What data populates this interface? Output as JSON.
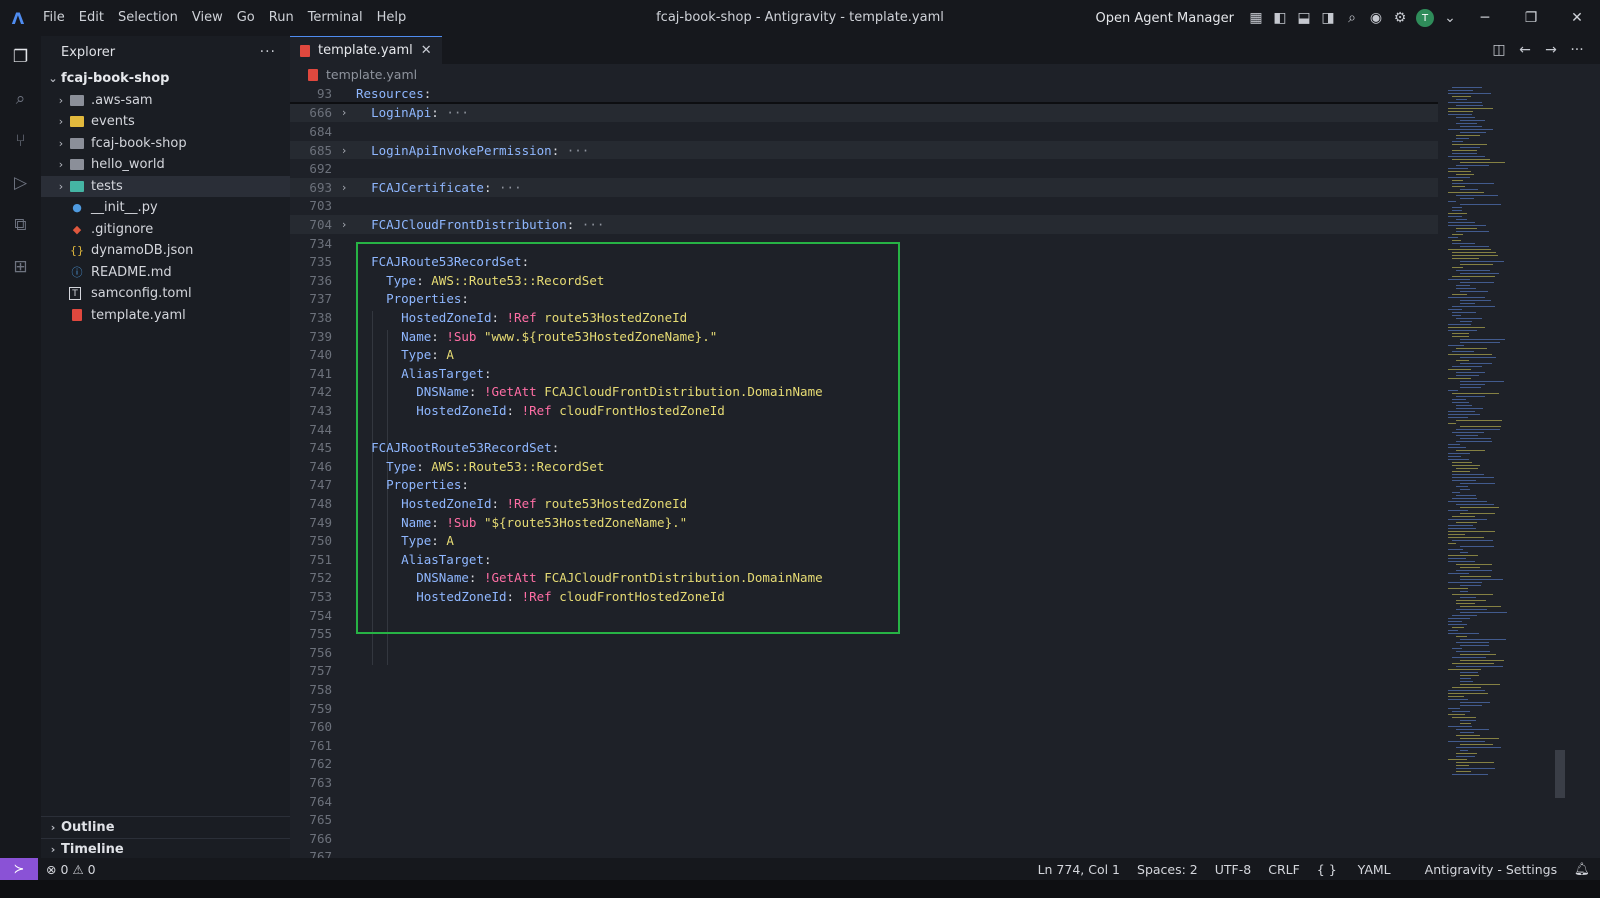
{
  "titlebar": {
    "menu": [
      "File",
      "Edit",
      "Selection",
      "View",
      "Go",
      "Run",
      "Terminal",
      "Help"
    ],
    "window_title": "fcaj-book-shop - Antigravity - template.yaml",
    "agent_manager": "Open Agent Manager",
    "avatar_initial": "T"
  },
  "sidebar": {
    "title": "Explorer",
    "root": "fcaj-book-shop",
    "items": [
      {
        "label": ".aws-sam",
        "kind": "folder"
      },
      {
        "label": "events",
        "kind": "folder"
      },
      {
        "label": "fcaj-book-shop",
        "kind": "folder"
      },
      {
        "label": "hello_world",
        "kind": "folder"
      },
      {
        "label": "tests",
        "kind": "folder"
      },
      {
        "label": "__init__.py",
        "kind": "python"
      },
      {
        "label": ".gitignore",
        "kind": "git"
      },
      {
        "label": "dynamoDB.json",
        "kind": "json"
      },
      {
        "label": "README.md",
        "kind": "info"
      },
      {
        "label": "samconfig.toml",
        "kind": "toml"
      },
      {
        "label": "template.yaml",
        "kind": "yaml"
      }
    ],
    "outline": "Outline",
    "timeline": "Timeline"
  },
  "editor": {
    "tab_label": "template.yaml",
    "breadcrumb": "template.yaml",
    "sticky": {
      "ln": "93",
      "key": "Resources"
    },
    "lines": {
      "l666": {
        "ln": "666",
        "key": "LoginApi"
      },
      "l684": {
        "ln": "684"
      },
      "l685": {
        "ln": "685",
        "key": "LoginApiInvokePermission"
      },
      "l692": {
        "ln": "692"
      },
      "l693": {
        "ln": "693",
        "key": "FCAJCertificate"
      },
      "l703": {
        "ln": "703"
      },
      "l704": {
        "ln": "704",
        "key": "FCAJCloudFrontDistribution"
      },
      "l734": {
        "ln": "734"
      },
      "l735": {
        "ln": "735",
        "key": "FCAJRoute53RecordSet"
      },
      "l736": {
        "ln": "736",
        "key": "Type",
        "value": "AWS::Route53::RecordSet"
      },
      "l737": {
        "ln": "737",
        "key": "Properties"
      },
      "l738": {
        "ln": "738",
        "key": "HostedZoneId",
        "tag": "!Ref",
        "value": "route53HostedZoneId"
      },
      "l739": {
        "ln": "739",
        "key": "Name",
        "tag": "!Sub",
        "value": "\"www.${route53HostedZoneName}.\""
      },
      "l740": {
        "ln": "740",
        "key": "Type",
        "value": "A"
      },
      "l741": {
        "ln": "741",
        "key": "AliasTarget"
      },
      "l742": {
        "ln": "742",
        "key": "DNSName",
        "tag": "!GetAtt",
        "value": "FCAJCloudFrontDistribution.DomainName"
      },
      "l743": {
        "ln": "743",
        "key": "HostedZoneId",
        "tag": "!Ref",
        "value": "cloudFrontHostedZoneId"
      },
      "l744": {
        "ln": "744"
      },
      "l745": {
        "ln": "745",
        "key": "FCAJRootRoute53RecordSet"
      },
      "l746": {
        "ln": "746",
        "key": "Type",
        "value": "AWS::Route53::RecordSet"
      },
      "l747": {
        "ln": "747",
        "key": "Properties"
      },
      "l748": {
        "ln": "748",
        "key": "HostedZoneId",
        "tag": "!Ref",
        "value": "route53HostedZoneId"
      },
      "l749": {
        "ln": "749",
        "key": "Name",
        "tag": "!Sub",
        "value": "\"${route53HostedZoneName}.\""
      },
      "l750": {
        "ln": "750",
        "key": "Type",
        "value": "A"
      },
      "l751": {
        "ln": "751",
        "key": "AliasTarget"
      },
      "l752": {
        "ln": "752",
        "key": "DNSName",
        "tag": "!GetAtt",
        "value": "FCAJCloudFrontDistribution.DomainName"
      },
      "l753": {
        "ln": "753",
        "key": "HostedZoneId",
        "tag": "!Ref",
        "value": "cloudFrontHostedZoneId"
      },
      "l754": {
        "ln": "754"
      },
      "l755": {
        "ln": "755"
      },
      "l756": {
        "ln": "756"
      },
      "l757": {
        "ln": "757"
      },
      "l758": {
        "ln": "758"
      },
      "l759": {
        "ln": "759"
      },
      "l760": {
        "ln": "760"
      },
      "l761": {
        "ln": "761"
      },
      "l762": {
        "ln": "762"
      },
      "l763": {
        "ln": "763"
      },
      "l764": {
        "ln": "764"
      },
      "l765": {
        "ln": "765"
      },
      "l766": {
        "ln": "766"
      },
      "l767": {
        "ln": "767"
      }
    }
  },
  "statusbar": {
    "errors": "0",
    "warnings": "0",
    "position": "Ln 774, Col 1",
    "spaces": "Spaces: 2",
    "encoding": "UTF-8",
    "eol": "CRLF",
    "language": "YAML",
    "settings": "Antigravity - Settings"
  },
  "colors": {
    "highlight_box": "#27b345",
    "yaml_key": "#8fb7ff",
    "yaml_tag": "#ff6ea5",
    "yaml_value": "#e6db74"
  }
}
